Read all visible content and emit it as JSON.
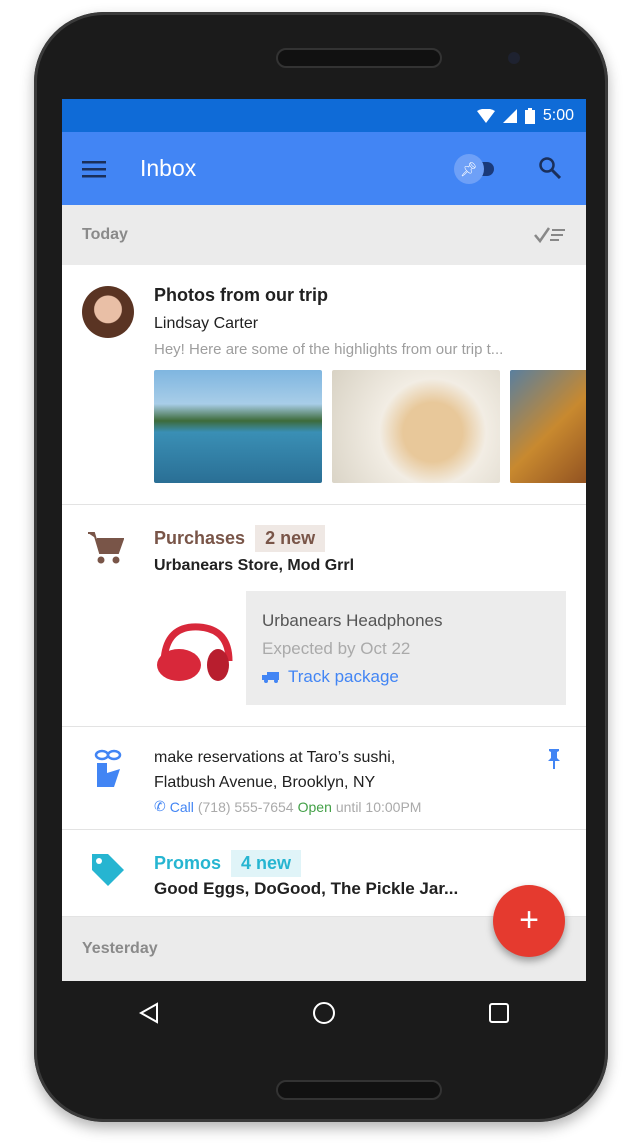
{
  "status": {
    "time": "5:00"
  },
  "appbar": {
    "title": "Inbox"
  },
  "sections": {
    "today": "Today",
    "yesterday": "Yesterday"
  },
  "email": {
    "subject": "Photos from our trip",
    "sender": "Lindsay Carter",
    "snippet": "Hey! Here are some of the highlights from our trip t..."
  },
  "purchases": {
    "label": "Purchases",
    "badge": "2 new",
    "senders": "Urbanears Store, Mod Grrl",
    "item": "Urbanears Headphones",
    "expected": "Expected by Oct 22",
    "action": "Track package"
  },
  "reminder": {
    "line1": "make reservations at Taro’s sushi,",
    "line2": "Flatbush Avenue, Brooklyn, NY",
    "call": "Call",
    "phone": "(718) 555-7654",
    "open": "Open",
    "hours": "until 10:00PM"
  },
  "promos": {
    "label": "Promos",
    "badge": "4 new",
    "senders": "Good Eggs, DoGood, The Pickle Jar..."
  },
  "fab": {
    "label": "+"
  },
  "colors": {
    "primary": "#4285f4",
    "status": "#0f6bd7",
    "purchases": "#795548",
    "promos": "#26b5d1",
    "fab": "#e53a2f",
    "open": "#43a047"
  }
}
